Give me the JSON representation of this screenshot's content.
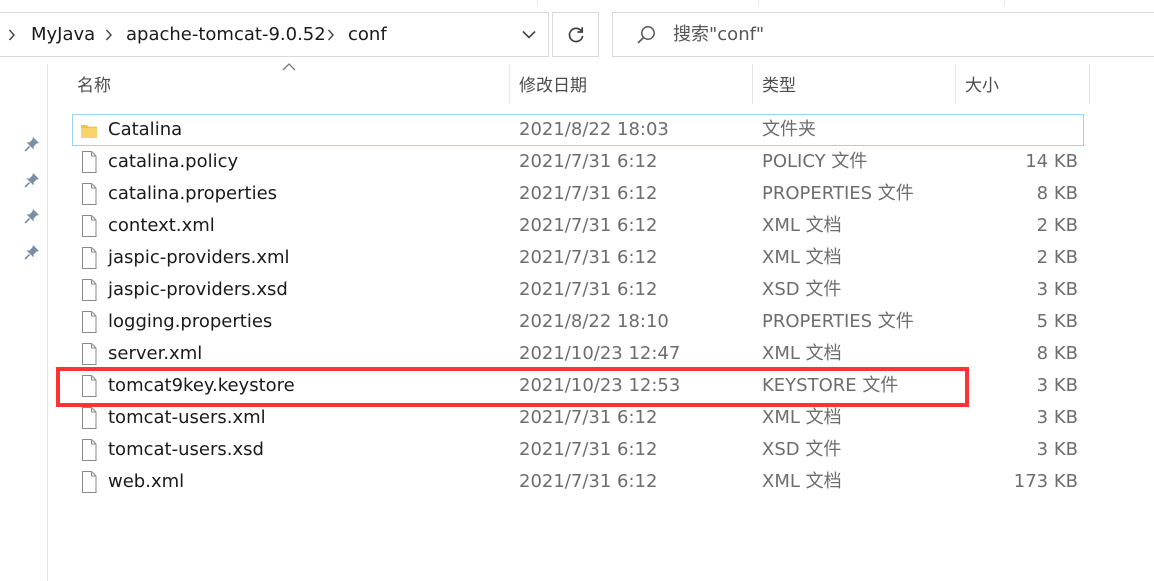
{
  "breadcrumb": [
    "MyJava",
    "apache-tomcat-9.0.52",
    "conf"
  ],
  "search": {
    "placeholder": "搜索\"conf\""
  },
  "columns": {
    "name": "名称",
    "date": "修改日期",
    "type": "类型",
    "size": "大小"
  },
  "sort": {
    "column": "name",
    "direction": "ascending"
  },
  "files": [
    {
      "name": "Catalina",
      "date": "2021/8/22 18:03",
      "type": "文件夹",
      "size": "",
      "icon": "folder-icon",
      "selected": true
    },
    {
      "name": "catalina.policy",
      "date": "2021/7/31 6:12",
      "type": "POLICY 文件",
      "size": "14 KB",
      "icon": "file-icon"
    },
    {
      "name": "catalina.properties",
      "date": "2021/7/31 6:12",
      "type": "PROPERTIES 文件",
      "size": "8 KB",
      "icon": "file-icon"
    },
    {
      "name": "context.xml",
      "date": "2021/7/31 6:12",
      "type": "XML 文档",
      "size": "2 KB",
      "icon": "file-icon"
    },
    {
      "name": "jaspic-providers.xml",
      "date": "2021/7/31 6:12",
      "type": "XML 文档",
      "size": "2 KB",
      "icon": "file-icon"
    },
    {
      "name": "jaspic-providers.xsd",
      "date": "2021/7/31 6:12",
      "type": "XSD 文件",
      "size": "3 KB",
      "icon": "file-icon"
    },
    {
      "name": "logging.properties",
      "date": "2021/8/22 18:10",
      "type": "PROPERTIES 文件",
      "size": "5 KB",
      "icon": "file-icon"
    },
    {
      "name": "server.xml",
      "date": "2021/10/23 12:47",
      "type": "XML 文档",
      "size": "8 KB",
      "icon": "file-icon"
    },
    {
      "name": "tomcat9key.keystore",
      "date": "2021/10/23 12:53",
      "type": "KEYSTORE 文件",
      "size": "3 KB",
      "icon": "file-icon",
      "highlighted": true
    },
    {
      "name": "tomcat-users.xml",
      "date": "2021/7/31 6:12",
      "type": "XML 文档",
      "size": "3 KB",
      "icon": "file-icon"
    },
    {
      "name": "tomcat-users.xsd",
      "date": "2021/7/31 6:12",
      "type": "XSD 文件",
      "size": "3 KB",
      "icon": "file-icon"
    },
    {
      "name": "web.xml",
      "date": "2021/7/31 6:12",
      "type": "XML 文档",
      "size": "173 KB",
      "icon": "file-icon"
    }
  ],
  "colors": {
    "highlight_box": "#ff3333",
    "selection_border": "#99d1ff",
    "folder": "#f4c24a"
  }
}
